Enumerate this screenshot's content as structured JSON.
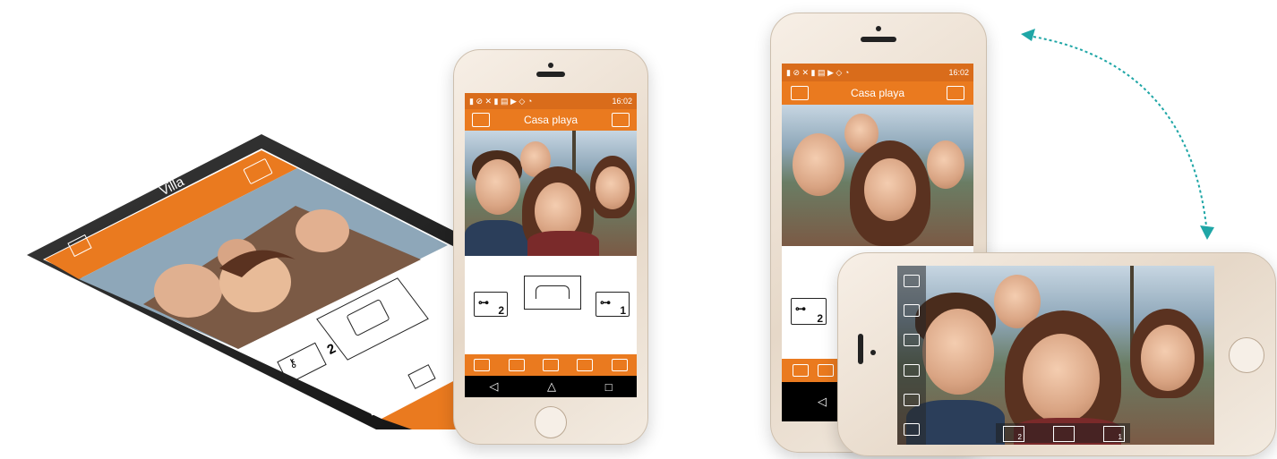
{
  "tablet": {
    "title": "Villa",
    "key_number": "2"
  },
  "phone_portrait": {
    "status_text": "16:02",
    "title": "Casa playa",
    "key_left_number": "2",
    "key_right_number": "1",
    "nav": {
      "back": "◁",
      "home": "△",
      "recent": "□"
    }
  },
  "phone_rear": {
    "status_text": "16:02",
    "title": "Casa playa",
    "key_number": "2"
  },
  "phone_landscape": {
    "key_left_number": "2",
    "key_right_number": "1"
  },
  "colors": {
    "accent": "#ea7a1f",
    "arrow": "#1fa6a6"
  }
}
